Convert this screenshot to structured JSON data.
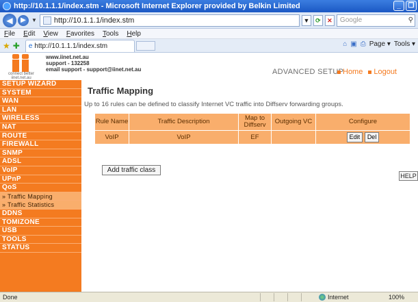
{
  "window": {
    "title": "http://10.1.1.1/index.stm - Microsoft Internet Explorer provided by Belkin Limited",
    "min_label": "_",
    "max_label": "❐"
  },
  "addressbar": {
    "back_label": "◀",
    "fwd_label": "▶",
    "url": "http://10.1.1.1/index.stm",
    "search_placeholder": "Google"
  },
  "menu": {
    "items": [
      "File",
      "Edit",
      "View",
      "Favorites",
      "Tools",
      "Help"
    ]
  },
  "tabs": {
    "active_tab": "http://10.1.1.1/index.stm",
    "tools": [
      "Page ▾",
      "Tools ▾"
    ]
  },
  "header": {
    "site": "www.iinet.net.au",
    "support": "support - 132258",
    "email": "email support - support@iinet.net.au",
    "slogan_1": "connect better",
    "slogan_2": "iinet.net.au",
    "section": "ADVANCED SETUP",
    "home_link": "Home",
    "logout_link": "Logout"
  },
  "sidebar": {
    "items": [
      {
        "label": "SETUP WIZARD",
        "sub": false
      },
      {
        "label": "SYSTEM",
        "sub": false
      },
      {
        "label": "WAN",
        "sub": false
      },
      {
        "label": "LAN",
        "sub": false
      },
      {
        "label": "WIRELESS",
        "sub": false
      },
      {
        "label": "NAT",
        "sub": false
      },
      {
        "label": "ROUTE",
        "sub": false
      },
      {
        "label": "FIREWALL",
        "sub": false
      },
      {
        "label": "SNMP",
        "sub": false
      },
      {
        "label": "ADSL",
        "sub": false
      },
      {
        "label": "VoIP",
        "sub": false
      },
      {
        "label": "UPnP",
        "sub": false
      },
      {
        "label": "QoS",
        "sub": false
      },
      {
        "label": "» Traffic Mapping",
        "sub": true
      },
      {
        "label": "» Traffic Statistics",
        "sub": true
      },
      {
        "label": "DDNS",
        "sub": false
      },
      {
        "label": "TOMIZONE",
        "sub": false
      },
      {
        "label": "USB",
        "sub": false
      },
      {
        "label": "TOOLS",
        "sub": false
      },
      {
        "label": "STATUS",
        "sub": false
      }
    ]
  },
  "main": {
    "title": "Traffic Mapping",
    "description": "Up to 16 rules can be defined to classify Internet VC traffic into Diffserv forwarding groups.",
    "columns": [
      "Rule Name",
      "Traffic Description",
      "Map to Diffserv",
      "Outgoing VC",
      "Configure"
    ],
    "rows": [
      {
        "rule_name": "VoIP",
        "traffic_description": "VoIP",
        "map_to": "EF",
        "outgoing_vc": ""
      }
    ],
    "edit_label": "Edit",
    "del_label": "Del",
    "add_label": "Add traffic class",
    "help_label": "HELP"
  },
  "status": {
    "left": "Done",
    "zone": "Internet",
    "zoom": "100%"
  }
}
